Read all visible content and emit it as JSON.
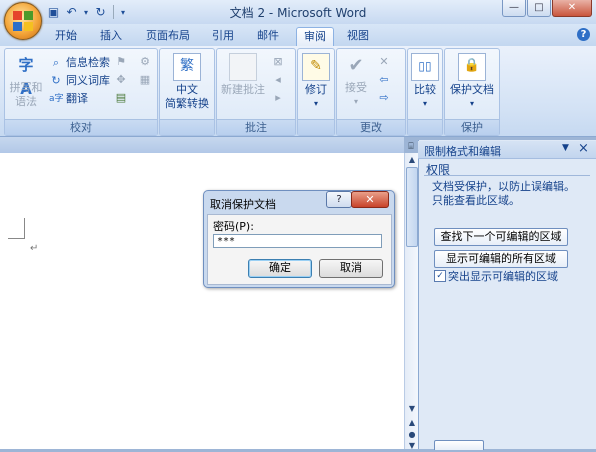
{
  "window": {
    "title": "文档 2 - Microsoft Word",
    "minimize": "—",
    "restore": "□",
    "close": "✕"
  },
  "qat": {
    "save_icon": "save-icon",
    "undo_icon": "undo-icon",
    "redo_icon": "redo-icon",
    "customize_icon": "dropdown-icon"
  },
  "tabs": [
    {
      "label": "开始"
    },
    {
      "label": "插入"
    },
    {
      "label": "页面布局"
    },
    {
      "label": "引用"
    },
    {
      "label": "邮件"
    },
    {
      "label": "审阅",
      "active": true
    },
    {
      "label": "视图"
    }
  ],
  "ribbon": {
    "proofing": {
      "label": "校对",
      "spelling": "拼写和\n语法",
      "research": "信息检索",
      "thesaurus": "同义词库",
      "translate": "翻译"
    },
    "chinese": {
      "label_line1": "中文",
      "label_line2": "简繁转换"
    },
    "comments": {
      "label": "批注",
      "new_comment": "新建批注"
    },
    "tracking": {
      "track_changes": "修订"
    },
    "changes": {
      "label": "更改",
      "accept": "接受"
    },
    "compare": {
      "compare": "比较"
    },
    "protect": {
      "label": "保护",
      "protect_document": "保护文档"
    }
  },
  "taskpane": {
    "title": "限制格式和编辑",
    "section": "权限",
    "desc_line1": "文档受保护，以防止误编辑。",
    "desc_line2": "只能查看此区域。",
    "find_next_button": "查找下一个可编辑的区域",
    "show_all_button": "显示可编辑的所有区域",
    "highlight_label": "突出显示可编辑的区域",
    "highlight_checked": true
  },
  "dialog": {
    "title": "取消保护文档",
    "help": "?",
    "close": "✕",
    "password_label": "密码(P):",
    "password_value": "***",
    "ok": "确定",
    "cancel": "取消"
  },
  "document": {
    "paragraph_mark": "↵"
  }
}
